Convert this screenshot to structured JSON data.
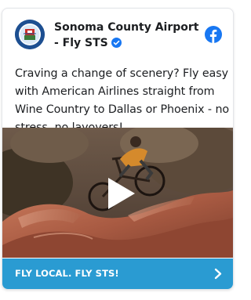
{
  "post": {
    "page_name": "Sonoma County Airport - Fly STS",
    "verified": true,
    "text": "Craving a change of scenery? Fly easy with American Airlines straight from Wine Country to Dallas or Phoenix - no stress, no layovers!",
    "cta_label": "FLY LOCAL. FLY STS!"
  },
  "icons": {
    "verified": "verified-badge-icon",
    "facebook": "facebook-icon",
    "play": "play-icon",
    "chevron": "chevron-right-icon"
  },
  "colors": {
    "facebook_blue": "#1877f2",
    "cta_background": "#2a9bd2",
    "text": "#1c1e21"
  }
}
